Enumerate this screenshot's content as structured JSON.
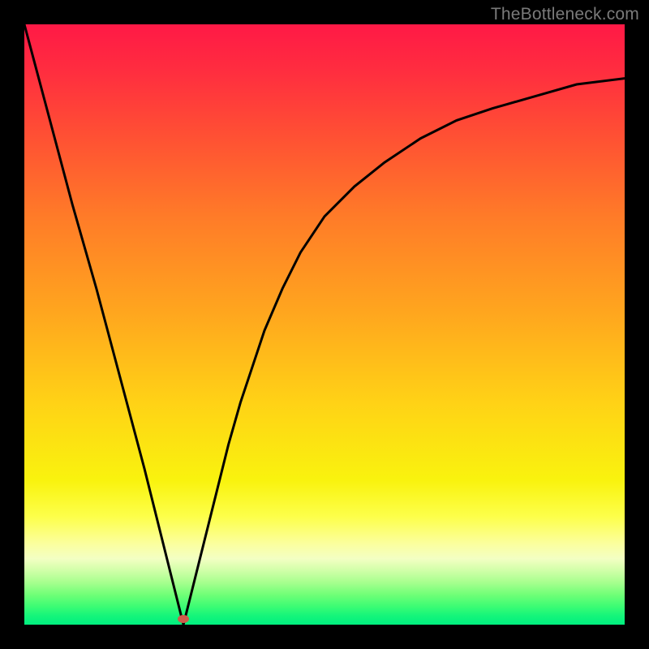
{
  "watermark": "TheBottleneck.com",
  "marker": {
    "x_pct": 26.5,
    "y_pct": 99.0
  },
  "chart_data": {
    "type": "line",
    "title": "",
    "xlabel": "",
    "ylabel": "",
    "xlim": [
      0,
      100
    ],
    "ylim": [
      0,
      100
    ],
    "grid": false,
    "legend": false,
    "series": [
      {
        "name": "bottleneck-curve",
        "x": [
          0,
          4,
          8,
          12,
          16,
          20,
          23,
          25,
          26.5,
          28,
          30,
          32,
          34,
          36,
          38,
          40,
          43,
          46,
          50,
          55,
          60,
          66,
          72,
          78,
          85,
          92,
          100
        ],
        "y": [
          100,
          85,
          70,
          56,
          41,
          26,
          14,
          6,
          0,
          6,
          14,
          22,
          30,
          37,
          43,
          49,
          56,
          62,
          68,
          73,
          77,
          81,
          84,
          86,
          88,
          90,
          91
        ]
      }
    ],
    "annotations": [
      {
        "type": "marker",
        "x": 26.5,
        "y": 0,
        "color": "#cf5a4a",
        "shape": "ellipse"
      }
    ],
    "background_gradient": {
      "direction": "vertical",
      "stops": [
        {
          "pos": 0.0,
          "color": "#ff1946"
        },
        {
          "pos": 0.18,
          "color": "#ff4e34"
        },
        {
          "pos": 0.48,
          "color": "#ffa61e"
        },
        {
          "pos": 0.76,
          "color": "#f9f30e"
        },
        {
          "pos": 0.89,
          "color": "#f3ffc3"
        },
        {
          "pos": 1.0,
          "color": "#00ef7f"
        }
      ]
    }
  }
}
